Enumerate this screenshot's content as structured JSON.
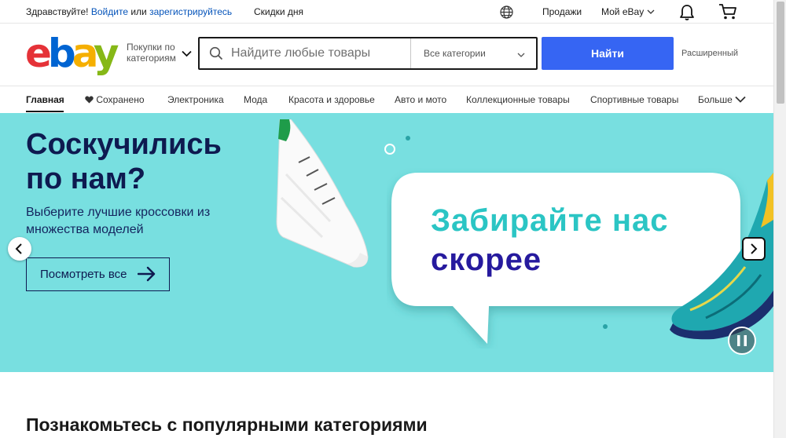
{
  "topbar": {
    "greeting": "Здравствуйте!",
    "sign_in": "Войдите",
    "or": "или",
    "register": "зарегистрируйтесь",
    "deals": "Скидки дня",
    "sell": "Продажи",
    "my_ebay": "Мой eBay"
  },
  "header": {
    "logo": {
      "e": "e",
      "b": "b",
      "a": "a",
      "y": "y"
    },
    "shop_by_category": "Покупки по категориям",
    "search_placeholder": "Найдите любые товары",
    "category_select": "Все категории",
    "search_button": "Найти",
    "advanced": "Расширенный"
  },
  "nav": {
    "items": [
      "Главная",
      "Сохранено",
      "Электроника",
      "Мода",
      "Красота и здоровье",
      "Авто и мото",
      "Коллекционные товары",
      "Спортивные товары",
      "Больше"
    ]
  },
  "banner": {
    "title": "Соскучились по нам?",
    "subtitle": "Выберите лучшие кроссовки из множества моделей",
    "cta": "Посмотреть все",
    "bubble_line1": "Забирайте нас",
    "bubble_line2": "скорее"
  },
  "section": {
    "title": "Познакомьтесь с популярными категориями"
  },
  "colors": {
    "accent": "#3665f3",
    "link": "#0654ba",
    "banner_bg": "#78dfe0",
    "headline": "#0e1a50"
  }
}
